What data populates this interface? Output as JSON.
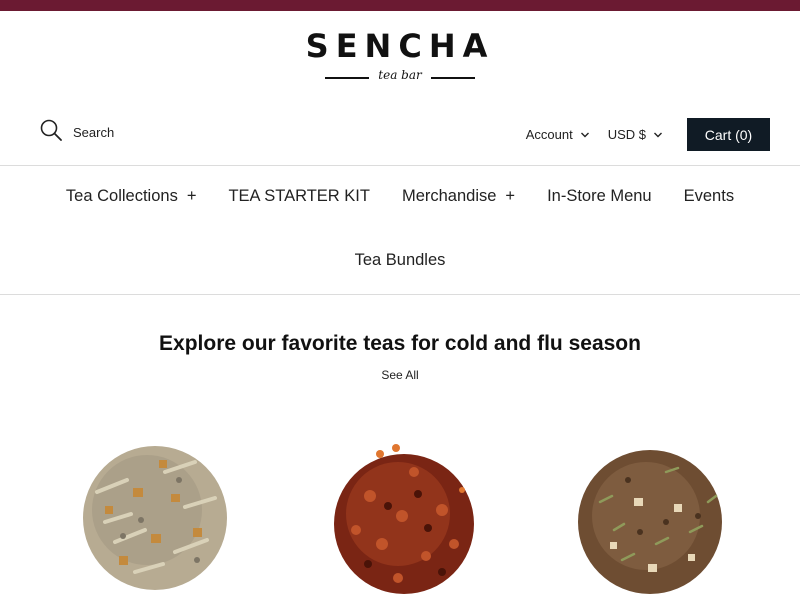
{
  "colors": {
    "accent_bar": "#6b1a32",
    "cart_button": "#101b25"
  },
  "brand": {
    "name": "SENCHA",
    "tagline": "tea bar"
  },
  "header": {
    "search_label": "Search",
    "account_label": "Account",
    "currency_label": "USD $",
    "cart_label": "Cart (0)"
  },
  "nav": {
    "items": [
      {
        "label": "Tea Collections",
        "expandable": true,
        "expand_symbol": "+"
      },
      {
        "label": "TEA STARTER KIT",
        "expandable": false
      },
      {
        "label": "Merchandise",
        "expandable": true,
        "expand_symbol": "+"
      },
      {
        "label": "In-Store Menu",
        "expandable": false
      },
      {
        "label": "Events",
        "expandable": false
      },
      {
        "label": "Tea Bundles",
        "expandable": false
      }
    ]
  },
  "section": {
    "title": "Explore our favorite teas for cold and flu season",
    "see_all": "See All"
  },
  "products": [
    {
      "image": "herbal-lemongrass-ginger-tea-pile"
    },
    {
      "image": "rosehip-hibiscus-tea-pile"
    },
    {
      "image": "rooibos-tea-pile"
    }
  ]
}
